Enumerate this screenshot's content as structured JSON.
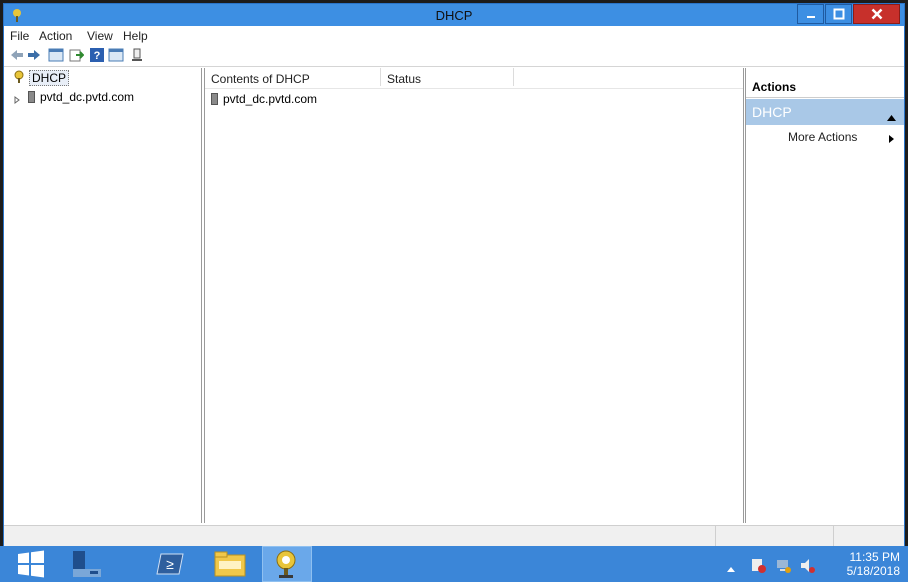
{
  "window": {
    "title": "DHCP"
  },
  "menu": [
    "File",
    "Action",
    "View",
    "Help"
  ],
  "tree": {
    "root_label": "DHCP",
    "children": [
      {
        "label": "pvtd_dc.pvtd.com"
      }
    ]
  },
  "list": {
    "columns": [
      "Contents of DHCP",
      "Status"
    ],
    "rows": [
      {
        "name": "pvtd_dc.pvtd.com",
        "status": ""
      }
    ]
  },
  "actions": {
    "header": "Actions",
    "group": "DHCP",
    "items": [
      "More Actions"
    ]
  },
  "taskbar": {
    "time": "11:35 PM",
    "date": "5/18/2018"
  },
  "colors": {
    "titlebar": "#3d8fe3",
    "taskbar": "#3b86d8",
    "actions_group": "#a9c8e7",
    "close_button": "#c7302b"
  },
  "icons": [
    "dhcp-icon",
    "back-arrow-icon",
    "forward-arrow-icon",
    "show-hide-console-tree-icon",
    "export-list-icon",
    "help-icon",
    "properties-icon",
    "server-icon",
    "start-icon",
    "server-manager-icon",
    "powershell-icon",
    "file-explorer-icon",
    "dhcp-app-icon",
    "tray-chevron-icon",
    "action-center-icon",
    "network-icon",
    "volume-icon"
  ]
}
